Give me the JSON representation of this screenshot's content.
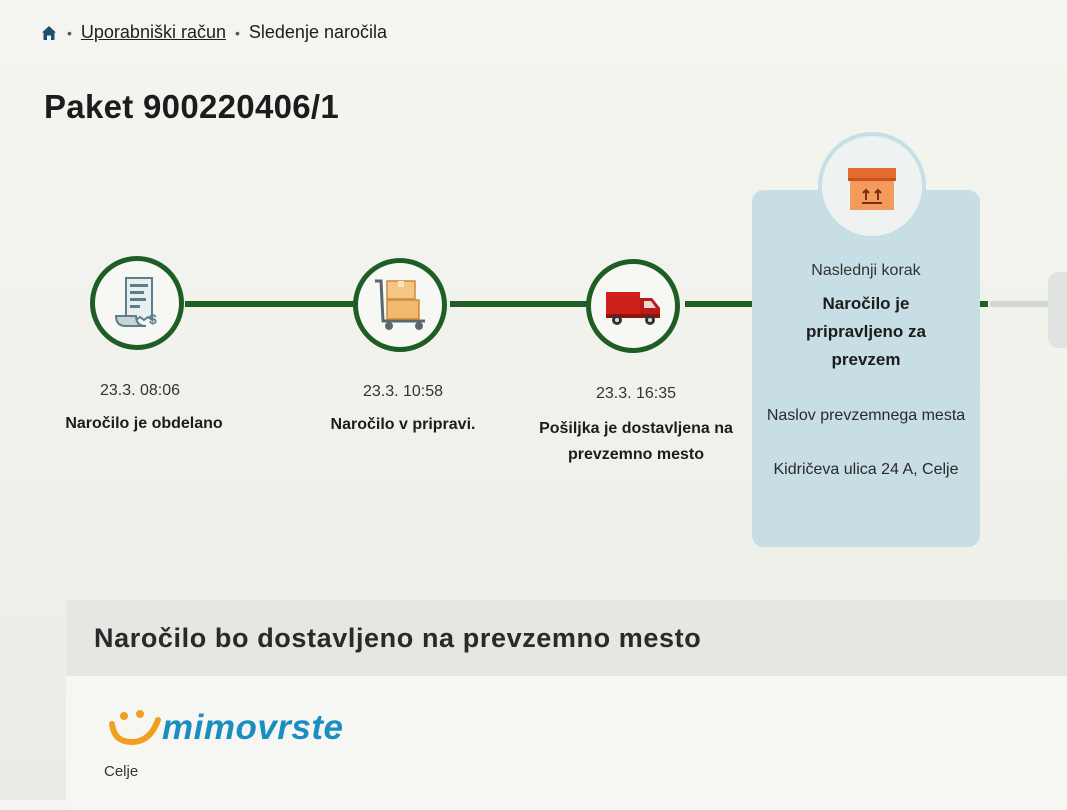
{
  "breadcrumb": {
    "items": [
      "Uporabniški račun",
      "Sledenje naročila"
    ]
  },
  "page": {
    "title": "Paket 900220406/1"
  },
  "tracking": {
    "steps": [
      {
        "time": "23.3. 08:06",
        "label": "Naročilo je obdelano",
        "icon": "receipt-icon",
        "status": "done"
      },
      {
        "time": "23.3. 10:58",
        "label": "Naročilo v pripravi.",
        "icon": "trolley-boxes-icon",
        "status": "done"
      },
      {
        "time": "23.3. 16:35",
        "label_line1": "Pošiljka je dostavljena na",
        "label_line2": "prevzemno mesto",
        "icon": "delivery-truck-icon",
        "status": "done"
      }
    ],
    "next": {
      "caption": "Naslednji korak",
      "title": "Naročilo je pripravljeno za prevzem",
      "address_label": "Naslov prevzemnega mesta",
      "address": "Kidričeva ulica 24 A, Celje",
      "icon": "package-box-icon"
    }
  },
  "delivery": {
    "heading": "Naročilo bo dostavljeno na prevzemno mesto",
    "logo_text": "mimovrste",
    "city": "Celje"
  },
  "colors": {
    "track_green": "#1e5e24",
    "next_card": "#c7dfe4",
    "logo_blue": "#1a8ec0",
    "logo_orange": "#f0a020",
    "truck_red": "#d0201c"
  }
}
